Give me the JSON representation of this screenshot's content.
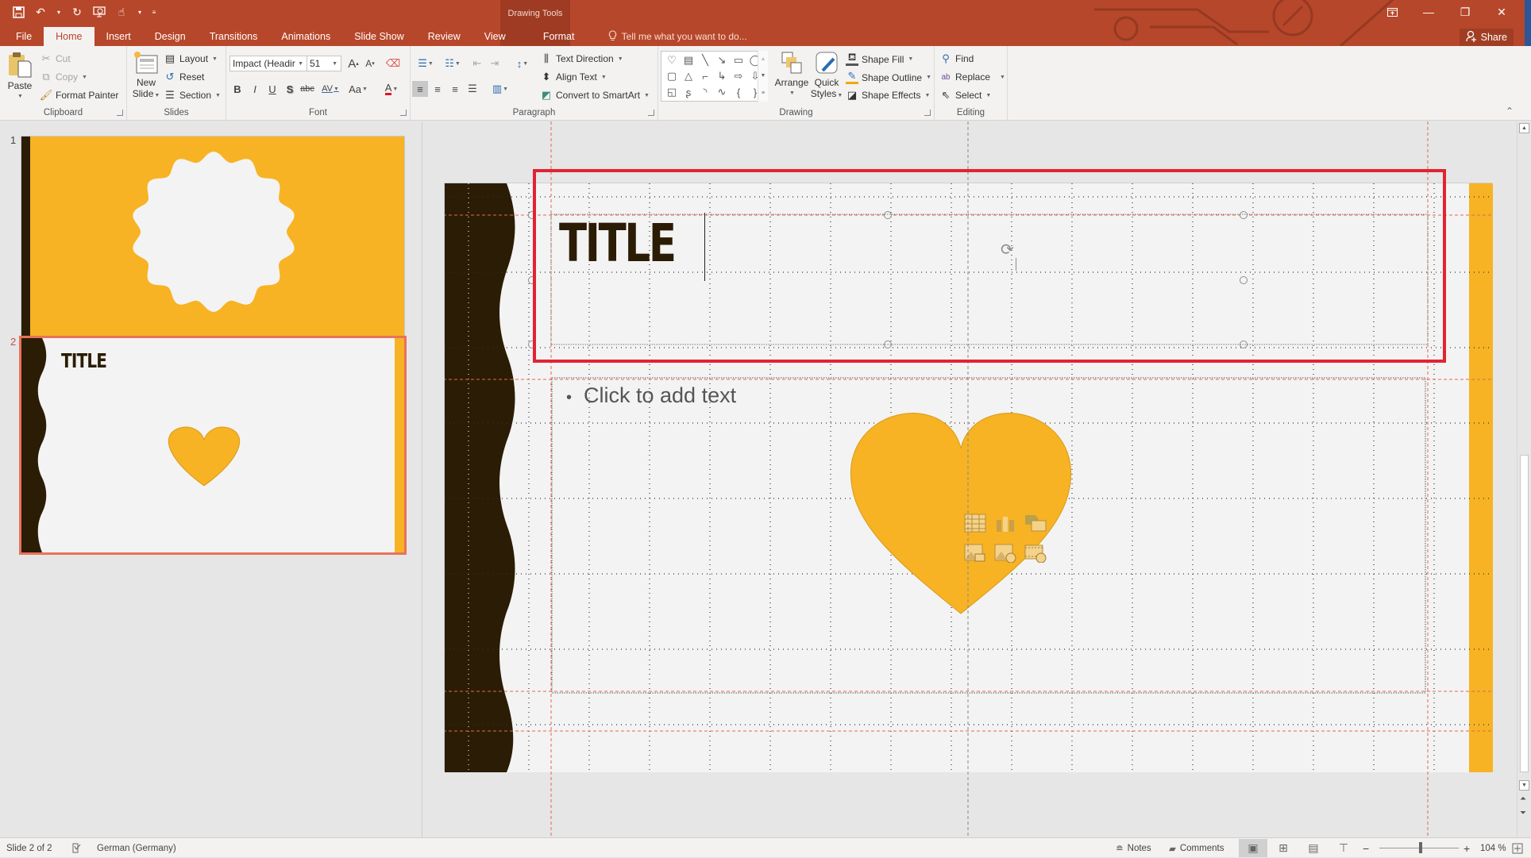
{
  "app": {
    "context_header": "Drawing Tools",
    "quick_access": [
      {
        "name": "save-icon",
        "glyph": "🖫"
      },
      {
        "name": "undo-icon",
        "glyph": "↶"
      },
      {
        "name": "redo-icon",
        "glyph": "↻"
      },
      {
        "name": "present-from-start-icon",
        "glyph": "⎚"
      },
      {
        "name": "touch-mode-icon",
        "glyph": "☝"
      }
    ],
    "window_controls": {
      "ribbon_display": "⊼",
      "minimize": "—",
      "restore": "❐",
      "close": "✕"
    },
    "share_label": "Share"
  },
  "tabs": [
    {
      "label": "File",
      "active": false
    },
    {
      "label": "Home",
      "active": true
    },
    {
      "label": "Insert",
      "active": false
    },
    {
      "label": "Design",
      "active": false
    },
    {
      "label": "Transitions",
      "active": false
    },
    {
      "label": "Animations",
      "active": false
    },
    {
      "label": "Slide Show",
      "active": false
    },
    {
      "label": "Review",
      "active": false
    },
    {
      "label": "View",
      "active": false
    },
    {
      "label": "Format",
      "active": false,
      "contextual": true
    }
  ],
  "tell_me_placeholder": "Tell me what you want to do...",
  "ribbon": {
    "clipboard": {
      "label": "Clipboard",
      "paste": "Paste",
      "cut": "Cut",
      "copy": "Copy",
      "format_painter": "Format Painter"
    },
    "slides": {
      "label": "Slides",
      "new_slide_1": "New",
      "new_slide_2": "Slide",
      "layout": "Layout",
      "reset": "Reset",
      "section": "Section"
    },
    "font": {
      "label": "Font",
      "font_name": "Impact (Headir",
      "font_size": "51",
      "grow": "A",
      "shrink": "A",
      "bold": "B",
      "italic": "I",
      "underline": "U",
      "shadow": "S",
      "strikethrough": "abc",
      "spacing": "AV",
      "change_case": "Aa",
      "font_color": "A",
      "font_color_hex": "#e81123"
    },
    "paragraph": {
      "label": "Paragraph",
      "text_direction": "Text Direction",
      "align_text": "Align Text",
      "convert_smartart": "Convert to SmartArt"
    },
    "drawing": {
      "label": "Drawing",
      "shapes": [
        "♡",
        "▤",
        "╲",
        "↘",
        "▭",
        "◯",
        "▢",
        "△",
        "⌐",
        "↳",
        "⇨",
        "⇩",
        "◱",
        "ʂ",
        "◝",
        "∿",
        "{",
        "}"
      ],
      "arrange": "Arrange",
      "quick_styles_1": "Quick",
      "quick_styles_2": "Styles",
      "shape_fill": "Shape Fill",
      "shape_outline": "Shape Outline",
      "shape_effects": "Shape Effects"
    },
    "editing": {
      "label": "Editing",
      "find": "Find",
      "replace": "Replace",
      "select": "Select"
    }
  },
  "thumbnails": [
    {
      "number": "1",
      "selected": false,
      "background": "#f7b324",
      "accent": "#2b1c05"
    },
    {
      "number": "2",
      "selected": true,
      "title": "TITLE",
      "background": "#f4f3f3",
      "accent": "#2b1c05",
      "shape_color": "#f7b324"
    }
  ],
  "slide": {
    "title": "TITLE",
    "body_placeholder": "Click to add text",
    "content_icons": [
      {
        "name": "insert-table-icon"
      },
      {
        "name": "insert-chart-icon"
      },
      {
        "name": "insert-smartart-icon"
      },
      {
        "name": "insert-picture-icon"
      },
      {
        "name": "insert-online-picture-icon"
      },
      {
        "name": "insert-video-icon"
      }
    ],
    "colors": {
      "dark": "#2b1c05",
      "gold": "#f7b324",
      "background": "#f4f3f3",
      "selection": "#e22333"
    }
  },
  "status": {
    "slide_info": "Slide 2 of 2",
    "language": "German (Germany)",
    "notes": "Notes",
    "comments": "Comments",
    "zoom_level": "104 %",
    "zoom_fraction": 0.52
  }
}
